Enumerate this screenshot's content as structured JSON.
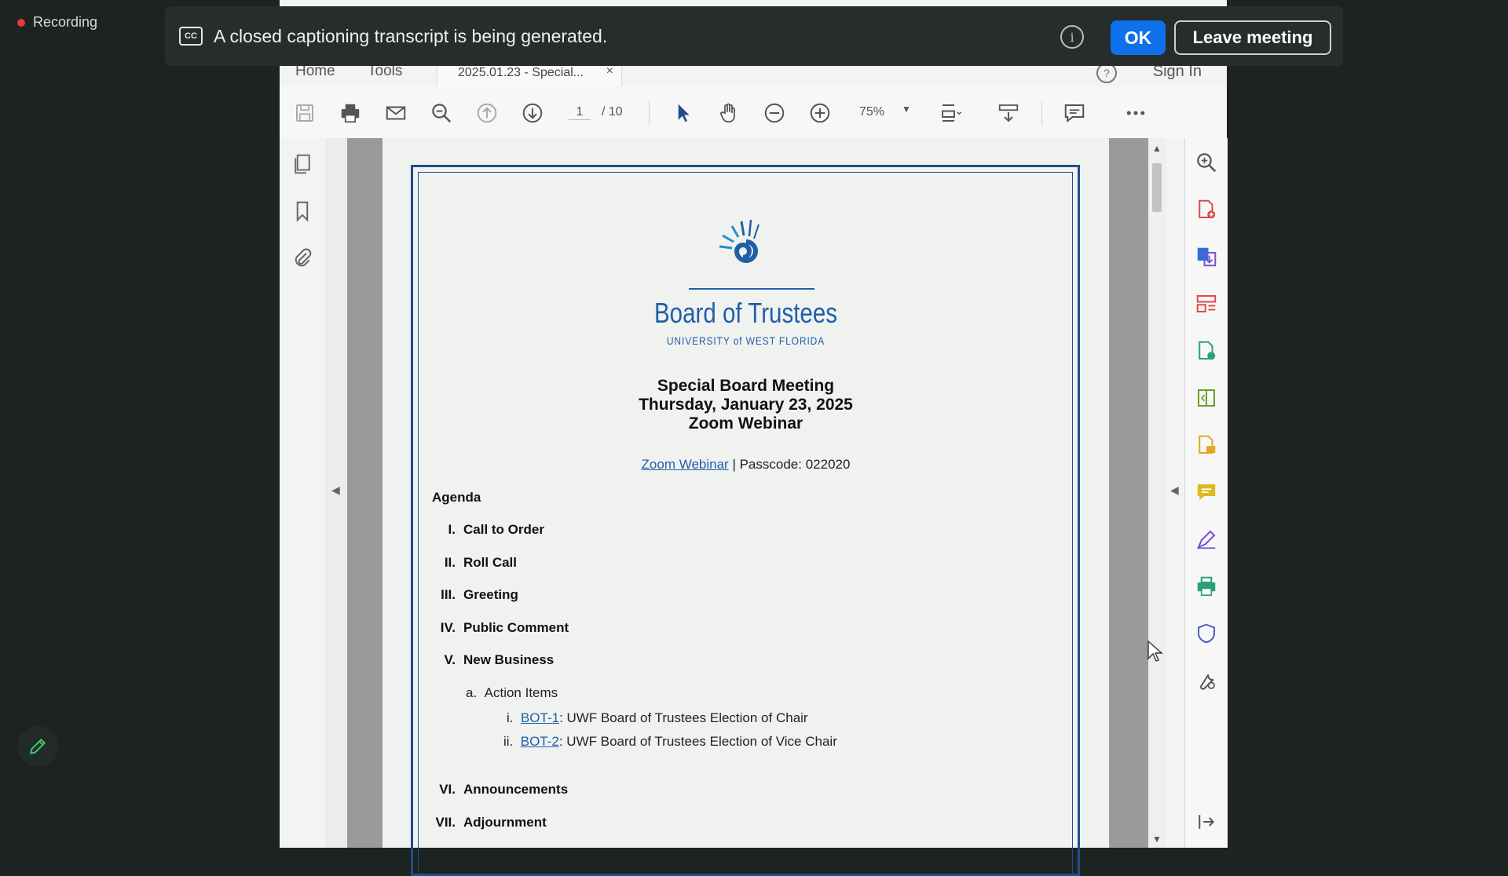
{
  "zoom": {
    "recording_label": "Recording",
    "caption_message": "A closed captioning transcript is being generated.",
    "cc_icon_label": "CC",
    "info_glyph": "i",
    "ok_label": "OK",
    "leave_label": "Leave meeting"
  },
  "acrobat": {
    "tabs": {
      "home": "Home",
      "tools": "Tools",
      "doc": "2025.01.23 - Special...",
      "close": "×"
    },
    "help_glyph": "?",
    "sign_in": "Sign In",
    "page_current": "1",
    "page_total": "/ 10",
    "zoom_level": "75%"
  },
  "document": {
    "org_title": "Board of Trustees",
    "org_subtitle": "UNIVERSITY of WEST FLORIDA",
    "meeting_title": "Special Board Meeting",
    "meeting_date": "Thursday, January 23, 2025",
    "meeting_venue": "Zoom Webinar",
    "webinar_link": "Zoom Webinar",
    "passcode": " | Passcode: 022020",
    "agenda_heading": "Agenda",
    "agenda_items": [
      {
        "num": "I.",
        "text": "Call to Order"
      },
      {
        "num": "II.",
        "text": "Roll Call"
      },
      {
        "num": "III.",
        "text": "Greeting"
      },
      {
        "num": "IV.",
        "text": "Public Comment"
      },
      {
        "num": "V.",
        "text": "New Business"
      },
      {
        "num": "VI.",
        "text": "Announcements"
      },
      {
        "num": "VII.",
        "text": "Adjournment"
      }
    ],
    "subsection": {
      "num": "a.",
      "text": "Action Items"
    },
    "action_items": [
      {
        "num": "i.",
        "link": "BOT-1",
        "text": ": UWF Board of Trustees Election of Chair"
      },
      {
        "num": "ii.",
        "link": "BOT-2",
        "text": ": UWF Board of Trustees Election of Vice Chair"
      }
    ]
  },
  "colors": {
    "accent_blue": "#0e71eb",
    "uwf_blue": "#1f5fa8",
    "recording_red": "#e53935"
  }
}
